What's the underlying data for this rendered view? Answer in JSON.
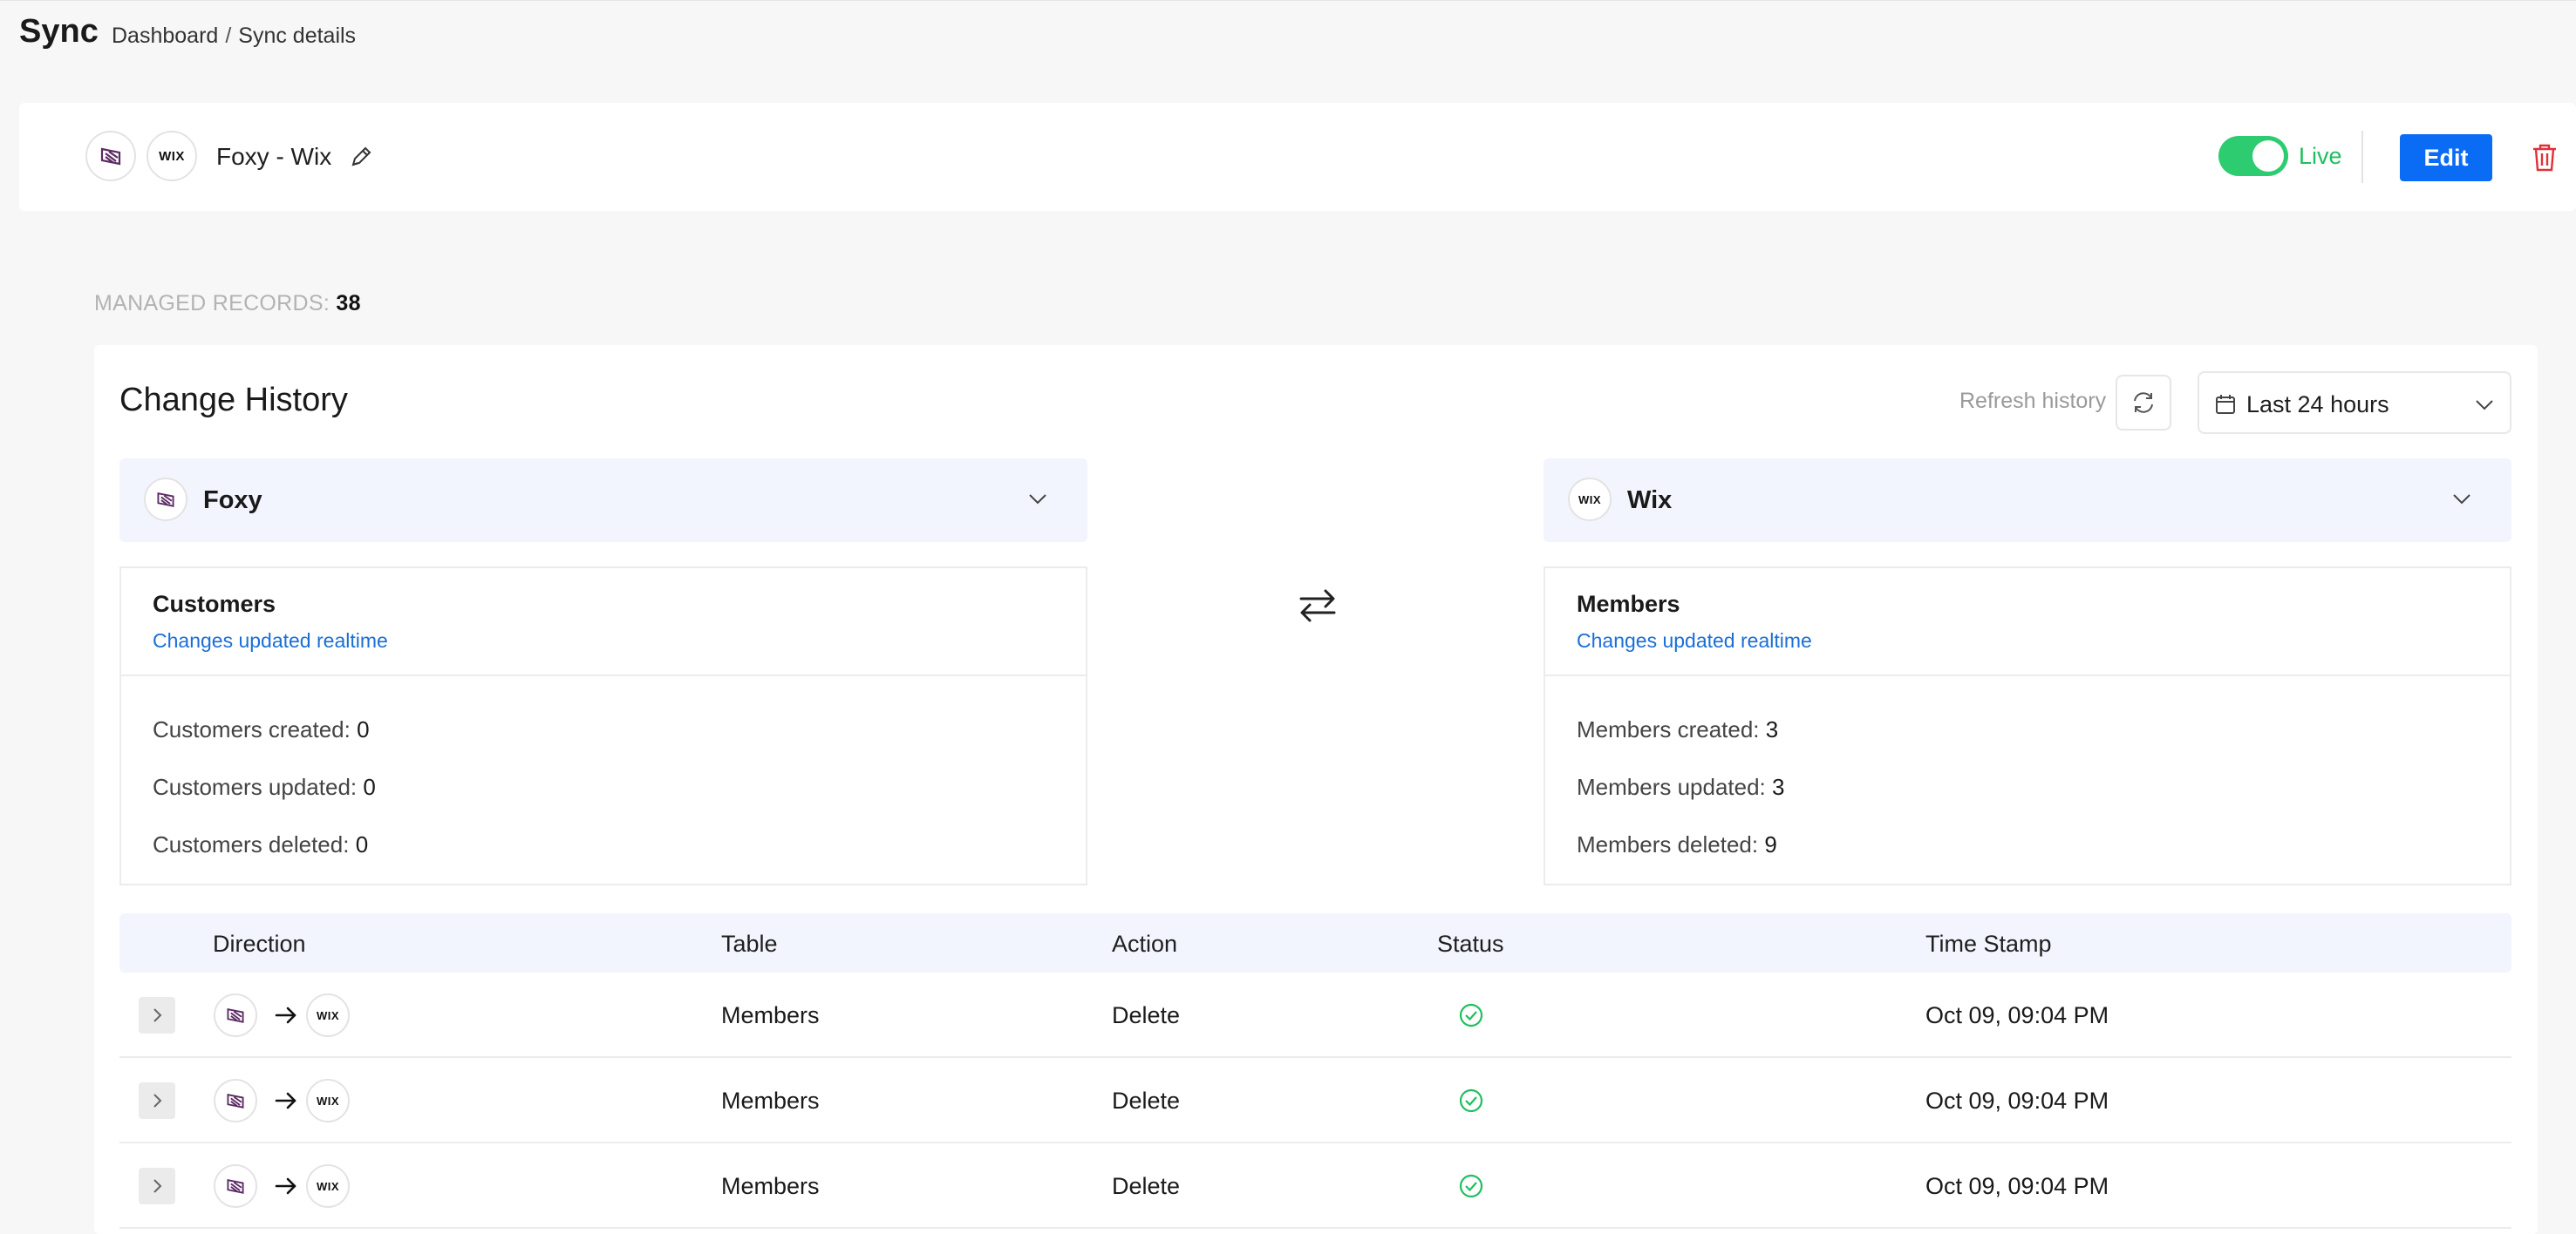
{
  "app": {
    "title": "Sync"
  },
  "breadcrumb": {
    "root": "Dashboard",
    "separator": "/",
    "current": "Sync details"
  },
  "sync": {
    "name": "Foxy - Wix",
    "status_label": "Live",
    "live": true,
    "edit_label": "Edit",
    "source_logo": "foxy-logo-icon",
    "target_logo": "wix-logo-icon",
    "target_logo_text": "WIX"
  },
  "managed": {
    "label": "MANAGED RECORDS:",
    "count": "38"
  },
  "history": {
    "title": "Change History",
    "refresh_label": "Refresh history",
    "range": "Last 24 hours",
    "source": {
      "app": "Foxy",
      "object": "Customers",
      "link": "Changes updated realtime",
      "stats": [
        {
          "label": "Customers created:",
          "value": "0"
        },
        {
          "label": "Customers updated:",
          "value": "0"
        },
        {
          "label": "Customers deleted:",
          "value": "0"
        }
      ]
    },
    "target": {
      "app": "Wix",
      "logo_text": "WIX",
      "object": "Members",
      "link": "Changes updated realtime",
      "stats": [
        {
          "label": "Members created:",
          "value": "3"
        },
        {
          "label": "Members updated:",
          "value": "3"
        },
        {
          "label": "Members deleted:",
          "value": "9"
        }
      ]
    },
    "columns": {
      "direction": "Direction",
      "table": "Table",
      "action": "Action",
      "status": "Status",
      "timestamp": "Time Stamp"
    },
    "rows": [
      {
        "table": "Members",
        "action": "Delete",
        "status": "success",
        "timestamp": "Oct 09, 09:04 PM"
      },
      {
        "table": "Members",
        "action": "Delete",
        "status": "success",
        "timestamp": "Oct 09, 09:04 PM"
      },
      {
        "table": "Members",
        "action": "Delete",
        "status": "success",
        "timestamp": "Oct 09, 09:04 PM"
      }
    ]
  },
  "colors": {
    "accent": "#0a6cf5",
    "live": "#2ecc71",
    "success": "#1fbf5f",
    "danger": "#e0303a",
    "link": "#1a6fd6"
  }
}
